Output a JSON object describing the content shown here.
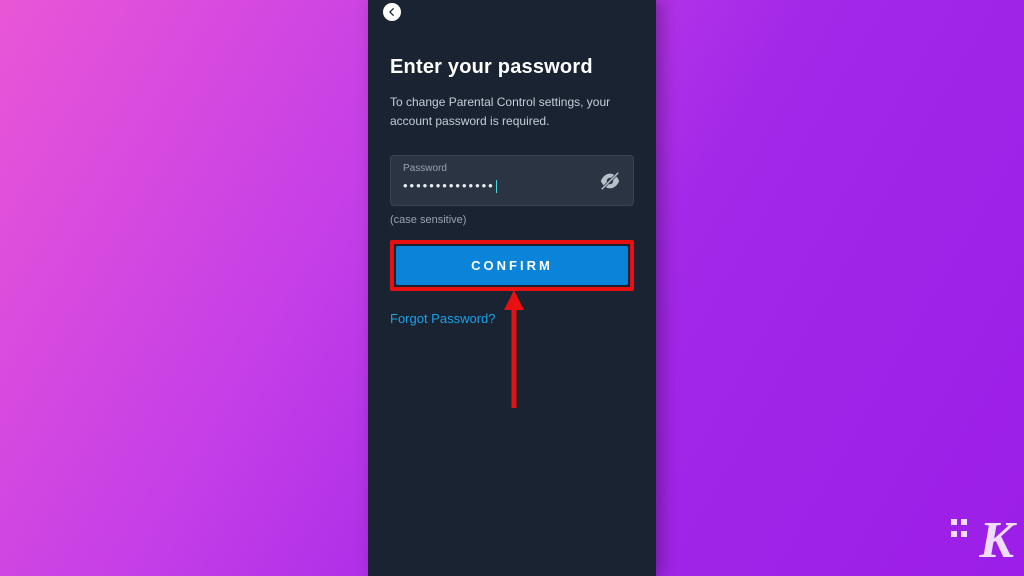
{
  "header": {
    "title": "Enter your password",
    "subtitle": "To change Parental Control settings, your account password is required."
  },
  "password": {
    "label": "Password",
    "masked_value": "••••••••••••••",
    "hint": "(case sensitive)"
  },
  "actions": {
    "confirm_label": "CONFIRM",
    "forgot_label": "Forgot Password?"
  },
  "watermark": "K"
}
